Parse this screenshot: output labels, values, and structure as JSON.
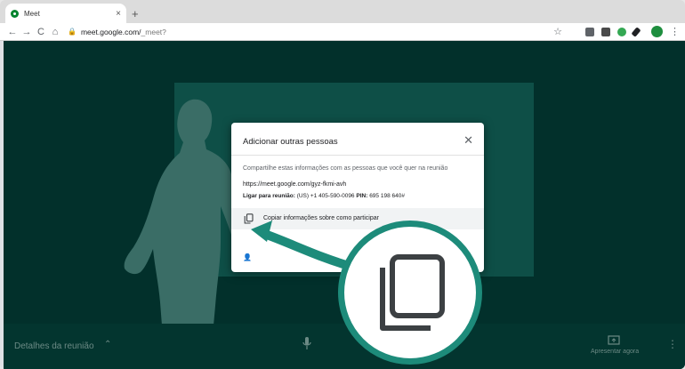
{
  "browser": {
    "tab_title": "Meet",
    "tab_close": "×",
    "new_tab": "+",
    "url_host": "meet.google.com/",
    "url_path": "_meet?",
    "nav_back": "←",
    "nav_forward": "→",
    "nav_reload": "C",
    "nav_home": "⌂",
    "star": "☆",
    "menu": "⋮"
  },
  "dialog": {
    "title": "Adicionar outras pessoas",
    "close": "✕",
    "description": "Compartilhe estas informações com as pessoas que você quer na reunião",
    "meeting_link": "https://meet.google.com/gyz-fkmi-avh",
    "phone_label": "Ligar para reunião:",
    "phone_number": "(US) +1 405-590-0096",
    "pin_label": "PIN:",
    "pin_value": "695 198 640#",
    "copy_label": "Copiar informações sobre como participar",
    "add_icon": "person-add-icon"
  },
  "bottom_bar": {
    "details_label": "Detalhes da reunião",
    "details_chevron": "⌃",
    "present_label": "Apresentar agora",
    "more": "⋮"
  },
  "colors": {
    "meet_background": "#02302b",
    "presenter_tile": "#0e4f47",
    "accent": "#1d8b7a"
  }
}
